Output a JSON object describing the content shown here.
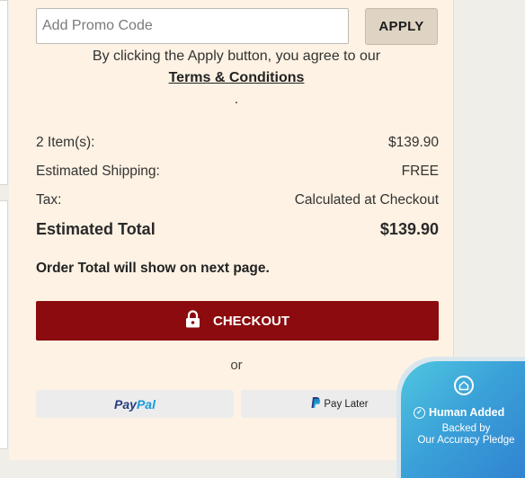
{
  "promo": {
    "placeholder": "Add Promo Code",
    "apply_label": "APPLY"
  },
  "agreement": {
    "text": "By clicking the Apply button, you agree to our",
    "link": "Terms & Conditions",
    "trailing": "."
  },
  "summary": {
    "items_label": "2 Item(s):",
    "items_value": "$139.90",
    "shipping_label": "Estimated Shipping:",
    "shipping_value": "FREE",
    "tax_label": "Tax:",
    "tax_value": "Calculated at Checkout",
    "total_label": "Estimated Total",
    "total_value": "$139.90"
  },
  "order_note": "Order Total will show on next page.",
  "checkout": {
    "label": "CHECKOUT",
    "icon": "lock-icon"
  },
  "or_text": "or",
  "payments": {
    "paypal_part1": "Pay",
    "paypal_part2": "Pal",
    "paylater": "Pay Later"
  },
  "badge": {
    "title": "Human Added",
    "line1": "Backed by",
    "line2": "Our Accuracy Pledge"
  },
  "colors": {
    "checkout_bg": "#8b0b0e",
    "panel_bg": "#fdf2e3",
    "apply_bg": "#dfd4c3",
    "badge_accent": "#3aa0d8"
  }
}
